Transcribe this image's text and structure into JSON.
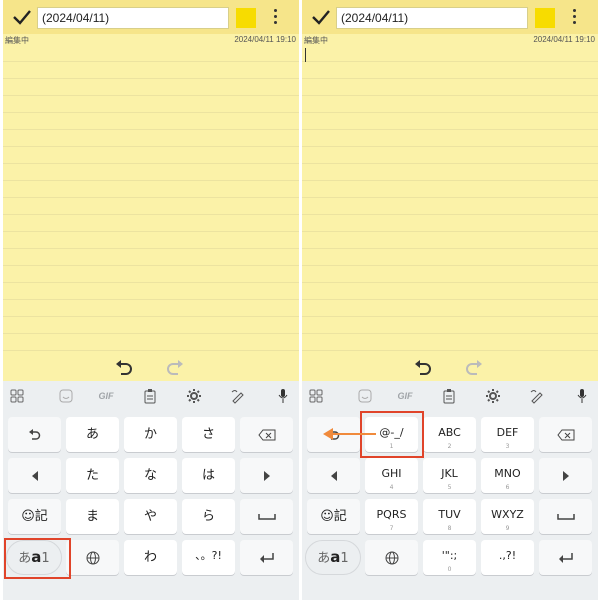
{
  "panels": [
    {
      "title_value": "(2024/04/11)",
      "status": "編集中",
      "timestamp": "2024/04/11 19:10",
      "toolbar_gif": "GIF",
      "keys": {
        "r1": [
          "あ",
          "か",
          "さ"
        ],
        "r2": [
          "た",
          "な",
          "は"
        ],
        "r3": [
          "ま",
          "や",
          "ら"
        ],
        "r4": [
          "わ",
          "、。?!"
        ],
        "emoji_key": "☺記",
        "mode_key_parts": [
          "あ",
          "a",
          "1"
        ]
      }
    },
    {
      "title_value": "(2024/04/11)",
      "status": "編集中",
      "timestamp": "2024/04/11 19:10",
      "toolbar_gif": "GIF",
      "keys": {
        "r1": [
          {
            "main": "@-_/",
            "sub": "1"
          },
          {
            "main": "ABC",
            "sub": "2"
          },
          {
            "main": "DEF",
            "sub": "3"
          }
        ],
        "r2": [
          {
            "main": "GHI",
            "sub": "4"
          },
          {
            "main": "JKL",
            "sub": "5"
          },
          {
            "main": "MNO",
            "sub": "6"
          }
        ],
        "r3": [
          {
            "main": "PQRS",
            "sub": "7"
          },
          {
            "main": "TUV",
            "sub": "8"
          },
          {
            "main": "WXYZ",
            "sub": "9"
          }
        ],
        "r4": [
          {
            "main": "'\":;",
            "sub": "0"
          },
          {
            "main": ".,?!",
            "sub": ""
          }
        ],
        "emoji_key": "☺記",
        "mode_key_parts": [
          "あ",
          "a",
          "1"
        ]
      }
    }
  ],
  "colors": {
    "note_bg": "#fbf2a8",
    "topbar_bg": "#f6e58a",
    "swatch": "#f7dc00",
    "highlight": "#e0442a",
    "swipe_arrow": "#f08a3c",
    "keyboard_bg": "#eceff1"
  },
  "icons": [
    "check-icon",
    "more-vert-icon",
    "undo-icon",
    "redo-icon",
    "grid-icon",
    "sticker-icon",
    "clipboard-icon",
    "settings-icon",
    "handwriting-icon",
    "mic-icon",
    "undo-key-icon",
    "backspace-icon",
    "arrow-left-icon",
    "arrow-right-icon",
    "space-icon",
    "globe-icon",
    "enter-icon"
  ]
}
